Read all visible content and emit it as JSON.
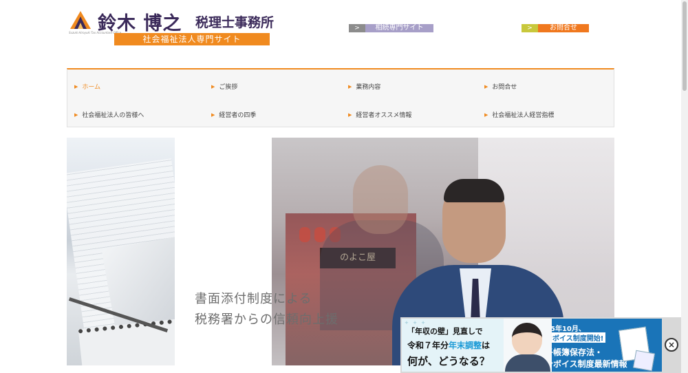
{
  "header": {
    "logo_name": "鈴木 博之",
    "logo_office": "税理士事務所",
    "logo_en": "Suzuki Hiroyuki Tax Accountant Office",
    "logo_sub": "社会福祉法人専門サイト",
    "links": [
      {
        "arrow": ">",
        "label": "相続専門サイト"
      },
      {
        "arrow": ">",
        "label": "お問合せ"
      }
    ]
  },
  "nav": {
    "items": [
      {
        "label": "ホーム",
        "active": true
      },
      {
        "label": "ご挨拶"
      },
      {
        "label": "業務内容"
      },
      {
        "label": "お問合せ"
      },
      {
        "label": "社会福祉法人の皆様へ"
      },
      {
        "label": "経営者の四季"
      },
      {
        "label": "経営者オススメ情報"
      },
      {
        "label": "社会福祉法人経営指標"
      }
    ],
    "bullet": "▶"
  },
  "hero": {
    "caption_line1": "書面添付制度による",
    "caption_line2": "税務署からの信頼向上援",
    "sign_text": "のよこ屋"
  },
  "banner": {
    "b1_stars": "+ + +",
    "b1_line1": "「年収の壁」見直しで",
    "b1_line2_a": "令和７年分",
    "b1_line2_hl": "年末調整",
    "b1_line2_b": "は",
    "b1_line3": "何が、どうなる？",
    "b3_line1": "令和5年10月、",
    "b3_line2": "インボイス制度開始!",
    "b3_line3": "電子帳簿保存法・",
    "b3_line4": "インボイス制度最新情報",
    "close": "×"
  },
  "colors": {
    "accent": "#f08a1f",
    "brand_text": "#3b2a5a",
    "consult_bg": "#a79fc8",
    "contact_bg": "#f0781e",
    "banner_blue": "#1a74b8"
  }
}
